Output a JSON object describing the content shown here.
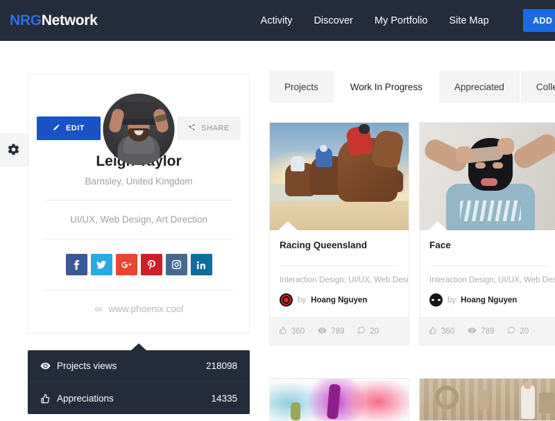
{
  "header": {
    "logo_primary": "NRG",
    "logo_secondary": "Network",
    "nav": [
      {
        "label": "Activity"
      },
      {
        "label": "Discover"
      },
      {
        "label": "My Portfolio"
      },
      {
        "label": "Site Map"
      }
    ],
    "add_work_label": "ADD W",
    "bg_color": "#242b3b",
    "accent_color": "#1a6ae0"
  },
  "settings_tab": {
    "icon": "gear-icon"
  },
  "profile": {
    "edit_label": "EDIT",
    "share_label": "SHARE",
    "name": "Leigh Taylor",
    "location": "Barnsley, United Kingdom",
    "tags": "UI/UX, Web Design, Art Direction",
    "website": "www.phoenix.cool",
    "social": [
      {
        "name": "facebook",
        "glyph": "f",
        "color": "#3b5998"
      },
      {
        "name": "twitter",
        "glyph": "t",
        "color": "#29a9e1"
      },
      {
        "name": "google-plus",
        "glyph": "g+",
        "color": "#e8472f"
      },
      {
        "name": "pinterest",
        "glyph": "p",
        "color": "#cb2027"
      },
      {
        "name": "instagram",
        "glyph": "i",
        "color": "#47698e"
      },
      {
        "name": "linkedin",
        "glyph": "in",
        "color": "#0e6d99"
      }
    ],
    "stats": [
      {
        "icon": "eye-icon",
        "label": "Projects views",
        "value": "218098"
      },
      {
        "icon": "thumbs-up-icon",
        "label": "Appreciations",
        "value": "14335"
      }
    ]
  },
  "tabs": [
    {
      "label": "Projects",
      "active": false
    },
    {
      "label": "Work In Progress",
      "active": true
    },
    {
      "label": "Appreciated",
      "active": false
    },
    {
      "label": "Colle",
      "active": false
    }
  ],
  "cards": [
    {
      "title": "Racing Queensland",
      "tags": "Interaction Design, UI/UX, Web Design",
      "by_label": "by",
      "author": "Hoang Nguyen",
      "likes": "360",
      "views": "789",
      "comments": "20",
      "thumb": "horse-racing-beach"
    },
    {
      "title": "Face",
      "tags": "Interaction Design, UI/UX, Web Design",
      "by_label": "by",
      "author": "Hoang Nguyen",
      "likes": "360",
      "views": "789",
      "comments": "20",
      "thumb": "masked-person"
    }
  ],
  "cards_row2": [
    {
      "thumb": "ink-splash-art"
    },
    {
      "thumb": "interior-woman"
    }
  ]
}
